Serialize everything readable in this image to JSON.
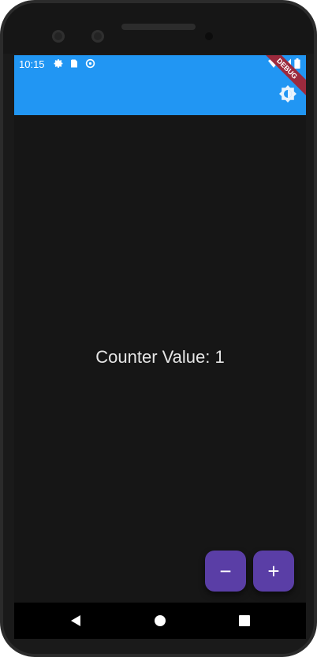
{
  "status_bar": {
    "time": "10:15",
    "icons": [
      "gear-icon",
      "sd-card-icon",
      "sync-icon",
      "wifi-icon",
      "signal-icon",
      "battery-icon"
    ]
  },
  "app_bar": {
    "color": "#2196f3",
    "theme_toggle_icon": "brightness-icon",
    "debug_banner": "DEBUG"
  },
  "content": {
    "counter_label": "Counter Value: 1"
  },
  "fabs": [
    {
      "name": "decrement",
      "label": "−",
      "color": "#5a3ea6"
    },
    {
      "name": "increment",
      "label": "+",
      "color": "#5a3ea6"
    }
  ],
  "nav_bar": {
    "buttons": [
      "back-icon",
      "home-icon",
      "recents-icon"
    ]
  }
}
